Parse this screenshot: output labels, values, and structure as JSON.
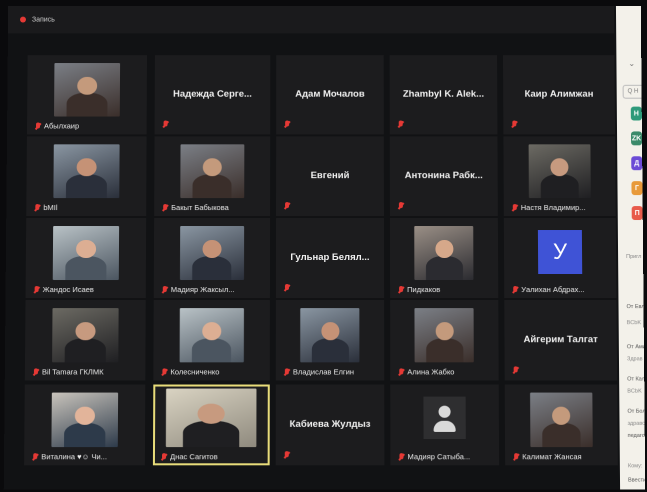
{
  "window": {
    "record_label": "Запись"
  },
  "participants": [
    {
      "id": "r1c1",
      "label": "Абылхаир",
      "type": "video"
    },
    {
      "id": "r1c2",
      "name": "Надежда Серге...",
      "type": "name"
    },
    {
      "id": "r1c3",
      "name": "Адам Мочалов",
      "type": "name"
    },
    {
      "id": "r1c4",
      "name": "Zhambyl K. Alek...",
      "type": "name"
    },
    {
      "id": "r1c5",
      "name": "Каир Алимжан",
      "type": "name"
    },
    {
      "id": "r2c1",
      "label": "bMIl",
      "type": "video"
    },
    {
      "id": "r2c2",
      "label": "Бакыт Бабыкова",
      "type": "video"
    },
    {
      "id": "r2c3",
      "name": "Евгений",
      "type": "name"
    },
    {
      "id": "r2c4",
      "name": "Антонина Рабк...",
      "type": "name"
    },
    {
      "id": "r2c5",
      "label": "Настя Владимир...",
      "type": "video"
    },
    {
      "id": "r3c1",
      "label": "Жандос Исаев",
      "type": "video"
    },
    {
      "id": "r3c2",
      "label": "Мадияр Жаксыл...",
      "type": "video"
    },
    {
      "id": "r3c3",
      "name": "Гульнар Белял...",
      "type": "name"
    },
    {
      "id": "r3c4",
      "label": "Пидкаков",
      "type": "video"
    },
    {
      "id": "r3c5",
      "label": "Уалихан Абдрах...",
      "type": "avatar",
      "avatar_letter": "У"
    },
    {
      "id": "r4c1",
      "label": "Bil Tamara ГКЛМК",
      "type": "video"
    },
    {
      "id": "r4c2",
      "label": "Колесниченко",
      "type": "video"
    },
    {
      "id": "r4c3",
      "label": "Владислав Елгин",
      "type": "video"
    },
    {
      "id": "r4c4",
      "label": "Алина Жабко",
      "type": "video"
    },
    {
      "id": "r4c5",
      "name": "Айгерим Талгат",
      "type": "name"
    },
    {
      "id": "r5c1",
      "label": "Виталина ♥☺ Чи...",
      "type": "video"
    },
    {
      "id": "r5c2",
      "label": "Днас Сагитов",
      "type": "video",
      "active": true
    },
    {
      "id": "r5c3",
      "name": "Кабиева Жулдыз",
      "type": "name"
    },
    {
      "id": "r5c4",
      "label": "Мадияр Сатыба...",
      "type": "generic"
    },
    {
      "id": "r5c5",
      "label": "Калимат Жансая",
      "type": "video"
    }
  ],
  "chat_panel": {
    "search_placeholder": "Q Н",
    "chips": [
      "Н",
      "ZK",
      "Д",
      "Г",
      "П"
    ],
    "texts": [
      "Пригл",
      "От Евл",
      "BCbK",
      "От Ами",
      "Здрав",
      "От Калим",
      "BCbK",
      "От Бол",
      "здравс",
      "педаго",
      "Кому:",
      "Ввести"
    ]
  },
  "colors": {
    "chip_colors": [
      "#2e9a7a",
      "#3a8a6a",
      "#6b4bd6",
      "#e89a3a",
      "#e85a4a"
    ],
    "accent": "#e8dc7a",
    "mic_muted": "#e53935"
  }
}
